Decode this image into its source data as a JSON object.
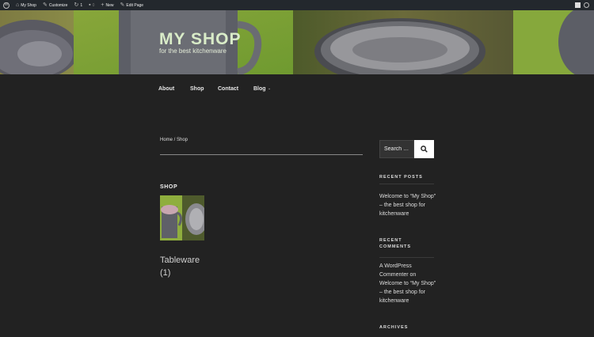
{
  "admin_bar": {
    "site_name": "My Shop",
    "customize": "Customize",
    "updates_count": "1",
    "comments_count": "0",
    "new": "New",
    "edit_page": "Edit Page"
  },
  "header": {
    "site_title": "MY SHOP",
    "tagline": "for the best kitchenware"
  },
  "nav": {
    "items": [
      "About",
      "Shop",
      "Contact",
      "Blog"
    ]
  },
  "breadcrumb": "Home / Shop",
  "main": {
    "heading": "SHOP",
    "category": {
      "name": "Tableware",
      "count": "(1)"
    }
  },
  "sidebar": {
    "search_placeholder": "Search …",
    "recent_posts_title": "RECENT POSTS",
    "recent_post": "Welcome to “My Shop” – the best shop for kitchenware",
    "recent_comments_title_1": "RECENT",
    "recent_comments_title_2": "COMMENTS",
    "recent_comment": "A WordPress Commenter on Welcome to “My Shop” – the best shop for kitchenware",
    "archives_title": "ARCHIVES"
  },
  "colors": {
    "background": "#222222",
    "admin_bar": "#23282d",
    "title": "#d9ecc8"
  }
}
